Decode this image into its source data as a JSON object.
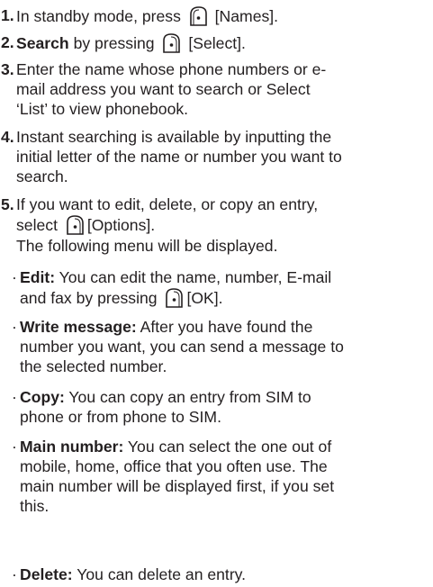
{
  "steps": [
    {
      "num": "1.",
      "pre": "In standby mode, press",
      "key_label": "[Names]."
    },
    {
      "num": "2.",
      "bold": "Search",
      "mid": "by pressing",
      "key_label": "[Select]."
    },
    {
      "num": "3.",
      "line1": "Enter the name whose phone numbers or e-",
      "line2": "mail address you want to search or Select",
      "line3": "‘List’ to view phonebook."
    },
    {
      "num": "4.",
      "line1": "Instant searching is available by inputting the",
      "line2": "initial letter of the name or number you want to",
      "line3": "search."
    },
    {
      "num": "5.",
      "line1": "If you want to edit, delete, or copy an entry,",
      "pre2": "select",
      "key_label": "[Options].",
      "line3": "The following menu will be displayed."
    }
  ],
  "options": [
    {
      "title": "Edit:",
      "line1": "You can edit the name, number, E-mail",
      "pre2": "and fax by pressing",
      "key_label": "[OK]."
    },
    {
      "title": "Write message:",
      "line1": "After you have found the",
      "line2": "number you want, you can send a message to",
      "line3": "the selected number."
    },
    {
      "title": "Copy:",
      "line1": "You can copy an entry from SIM to",
      "line2": "phone or from phone to SIM."
    },
    {
      "title": "Main number:",
      "line1": "You can select the one out of",
      "line2": "mobile, home, office that you often use. The",
      "line3": "main number will be displayed first, if you set",
      "line4": "this."
    },
    {
      "title": "Delete:",
      "line1": "You can delete an entry."
    }
  ],
  "bullet_char": "·",
  "icons": {
    "left_soft_key": "left-soft-key-icon",
    "right_soft_key": "right-soft-key-icon"
  }
}
